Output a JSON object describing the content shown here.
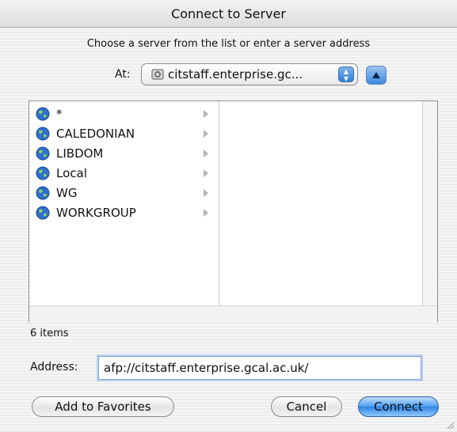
{
  "window": {
    "title": "Connect to Server"
  },
  "instructions": "Choose a server from the list or enter a server address",
  "location": {
    "label": "At:",
    "value": "citstaff.enterprise.gc..."
  },
  "browser": {
    "items": [
      {
        "label": "*"
      },
      {
        "label": "CALEDONIAN"
      },
      {
        "label": "LIBDOM"
      },
      {
        "label": "Local"
      },
      {
        "label": "WG"
      },
      {
        "label": "WORKGROUP"
      }
    ],
    "count_text": "6 items"
  },
  "address": {
    "label": "Address:",
    "value": "afp://citstaff.enterprise.gcal.ac.uk/"
  },
  "buttons": {
    "add_favorites": "Add to Favorites",
    "cancel": "Cancel",
    "connect": "Connect"
  },
  "colors": {
    "accent": "#3a8ae0",
    "globe": "#2f6fd0"
  }
}
